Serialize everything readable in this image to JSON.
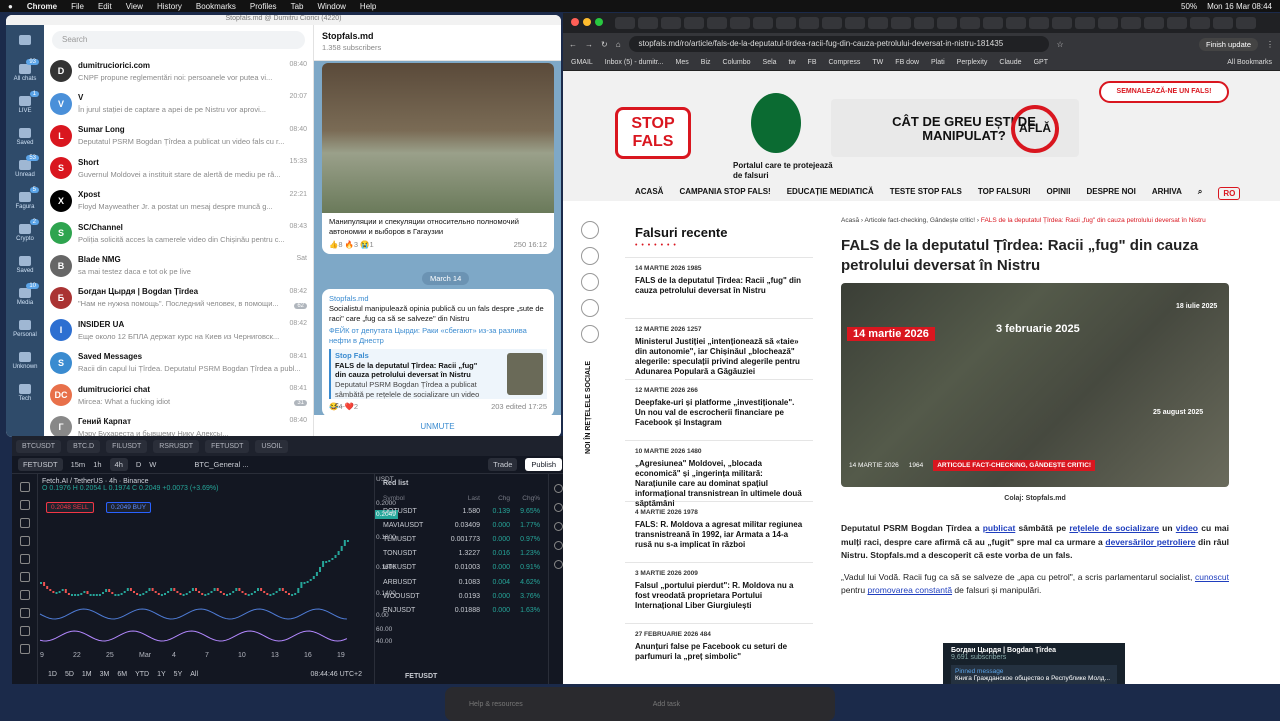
{
  "menubar": {
    "app": "Chrome",
    "items": [
      "File",
      "Edit",
      "View",
      "History",
      "Bookmarks",
      "Profiles",
      "Tab",
      "Window",
      "Help"
    ],
    "battery": "50%",
    "clock": "Mon 16 Mar 08:44"
  },
  "telegram": {
    "title": "Stopfals.md @ Dumitru Ciorici (4220)",
    "search_placeholder": "Search",
    "rail": [
      {
        "label": "All chats",
        "badge": "93"
      },
      {
        "label": "LIVE",
        "badge": "1"
      },
      {
        "label": "Saved",
        "badge": ""
      },
      {
        "label": "Unread",
        "badge": "53"
      },
      {
        "label": "Fagura",
        "badge": "5"
      },
      {
        "label": "Crypto",
        "badge": "2"
      },
      {
        "label": "Saved",
        "badge": ""
      },
      {
        "label": "Media",
        "badge": "10"
      },
      {
        "label": "Personal",
        "badge": ""
      },
      {
        "label": "Unknown",
        "badge": ""
      },
      {
        "label": "Tech",
        "badge": ""
      }
    ],
    "chats": [
      {
        "name": "dumitruciorici.com",
        "preview": "CNPF propune reglementări noi: persoanele vor putea vi...",
        "time": "08:40",
        "unread": "",
        "color": "#333",
        "initial": "D"
      },
      {
        "name": "V",
        "preview": "În jurul stației de captare a apei de pe Nistru vor aprovi...",
        "time": "20:07",
        "unread": "",
        "color": "#4a90d9",
        "initial": "V"
      },
      {
        "name": "Sumar Long",
        "preview": "Deputatul PSRM Bogdan Țîrdea a publicat un video fals cu r...",
        "time": "08:40",
        "unread": "",
        "color": "#d9161f",
        "initial": "L"
      },
      {
        "name": "Short",
        "preview": "Guvernul Moldovei a instituit stare de alertă de mediu pe râ...",
        "time": "15:33",
        "unread": "",
        "color": "#d9161f",
        "initial": "S"
      },
      {
        "name": "Xpost",
        "preview": "Floyd Mayweather Jr. a postat un mesaj despre muncă g...",
        "time": "22:21",
        "unread": "",
        "color": "#000",
        "initial": "X"
      },
      {
        "name": "SC/Channel",
        "preview": "Poliția solicită acces la camerele video din Chișinău pentru c...",
        "time": "08:43",
        "unread": "",
        "color": "#2ea44f",
        "initial": "S"
      },
      {
        "name": "Blade NMG",
        "preview": "sa mai testez daca e tot ok pe live",
        "time": "Sat",
        "unread": "",
        "color": "#666",
        "initial": "B"
      },
      {
        "name": "Богдан Цырдя | Bogdan Țîrdea",
        "preview": "\"Нам не нужна помощь\". Последний человек, в помощи...",
        "time": "08:42",
        "unread": "62",
        "color": "#a33",
        "initial": "Б"
      },
      {
        "name": "INSIDER UA",
        "preview": "Еще около 12 БПЛА держат курс на Киев из Черниговск...",
        "time": "08:42",
        "unread": "",
        "color": "#2d6fd1",
        "initial": "I"
      },
      {
        "name": "Saved Messages",
        "preview": "Racii din capul lui Țîrdea. Deputatul PSRM Bogdan Țîrdea a publ...",
        "time": "08:41",
        "unread": "",
        "color": "#3a8bd0",
        "initial": "S"
      },
      {
        "name": "dumitruciorici chat",
        "preview": "Mircea: What a fucking idiot",
        "time": "08:41",
        "unread": "31",
        "color": "#e8704a",
        "initial": "DC"
      },
      {
        "name": "Гений Карпат",
        "preview": "Мэру Бухареста и бывшему Нику Алексы...",
        "time": "08:40",
        "unread": "",
        "color": "#888",
        "initial": "Г"
      }
    ],
    "channel": {
      "name": "Stopfals.md",
      "subs": "1.358 subscribers",
      "unmute": "UNMUTE",
      "date": "March 14",
      "post1": {
        "text": "Манипуляции и спекуляции относительно полномочий автономии и выборов в Гагаузии",
        "reactions": "👍8  🔥3  😭1",
        "views": "250",
        "time": "16:12"
      },
      "post2": {
        "author": "Stopfals.md",
        "line1": "Socialistul manipulează opinia publică cu un fals despre „sute de raci\" care „fug ca să se salveze\" din Nistru",
        "line2": "ФЕЙК от депутата Цырди: Раки «сбегают» из-за разлива нефти в Днестр",
        "prev_site": "Stop Fals",
        "prev_title": "FALS de la deputatul Țîrdea: Racii „fug\" din cauza petrolului deversat în Nistru",
        "prev_desc": "Deputatul PSRM Bogdan Țîrdea a publicat sâmbătă pe rețelele de socializare un video c...",
        "reactions": "😂4  ❤️2",
        "views": "203",
        "time": "edited 17:25"
      }
    }
  },
  "tradingview": {
    "tabs": [
      "BTCUSDT",
      "BTC.D",
      "FILUSDT",
      "RSRUSDT",
      "FETUSDT",
      "USOIL"
    ],
    "symbol": "FETUSDT",
    "intervals": [
      "15m",
      "1h",
      "4h",
      "D",
      "W"
    ],
    "trade": "Trade",
    "publish": "Publish",
    "search": "BTC_General ...",
    "info": "Fetch.AI / TetherUS · 4h · Binance",
    "ohlc": "O 0.1976 H 0.2054 L 0.1974 C 0.2049 +0.0073 (+3.69%)",
    "sell": "0.2048 SELL",
    "buy": "0.2049 BUY",
    "price": "0.2049",
    "axis": [
      "0.2000",
      "0.1800",
      "0.1600",
      "0.1400",
      "0.00",
      "60.00",
      "40.00"
    ],
    "time_labels": [
      "9",
      "22",
      "25",
      "Mar",
      "4",
      "7",
      "10",
      "13",
      "16",
      "19"
    ],
    "ranges": [
      "1D",
      "5D",
      "1M",
      "3M",
      "6M",
      "YTD",
      "1Y",
      "5Y",
      "All"
    ],
    "clock": "08:44:46 UTC+2",
    "currency": "USDT",
    "watchlist": {
      "title": "Red list",
      "cols": [
        "Symbol",
        "Last",
        "Chg",
        "Chg%"
      ],
      "rows": [
        {
          "s": "DOTUSDT",
          "l": "1.580",
          "c": "0.139",
          "p": "9.65%"
        },
        {
          "s": "MAVIAUSDT",
          "l": "0.03409",
          "c": "0.000",
          "p": "1.77%"
        },
        {
          "s": "TLMUSDT",
          "l": "0.001773",
          "c": "0.000",
          "p": "0.97%"
        },
        {
          "s": "TONUSDT",
          "l": "1.3227",
          "c": "0.016",
          "p": "1.23%"
        },
        {
          "s": "UTKUSDT",
          "l": "0.01003",
          "c": "0.000",
          "p": "0.91%"
        },
        {
          "s": "ARBUSDT",
          "l": "0.1083",
          "c": "0.004",
          "p": "4.62%"
        },
        {
          "s": "WOOUSDT",
          "l": "0.0193",
          "c": "0.000",
          "p": "3.76%"
        },
        {
          "s": "ENJUSDT",
          "l": "0.01888",
          "c": "0.000",
          "p": "1.63%"
        }
      ],
      "footer": "FETUSDT"
    }
  },
  "chrome": {
    "url": "stopfals.md/ro/article/fals-de-la-deputatul-tirdea-racii-fug-din-cauza-petrolului-deversat-in-nistru-181435",
    "finish": "Finish update",
    "bookmarks": [
      "GMAIL",
      "Inbox (5) - dumitr...",
      "Mes",
      "Biz",
      "Columbo",
      "Sela",
      "tw",
      "FB",
      "Compress",
      "TW",
      "FB dow",
      "Plati",
      "Perplexity",
      "Claude",
      "GPT"
    ],
    "all_bookmarks": "All Bookmarks"
  },
  "site": {
    "logo": "STOP FALS",
    "tagline": "Portalul care te protejează de falsuri",
    "banner_q": "CÂT DE GREU EȘTI DE MANIPULAT?",
    "banner_a": "AFLĂ",
    "report": "SEMNALEAZĂ-NE UN FALS!",
    "nav": [
      "ACASĂ",
      "CAMPANIA STOP FALS!",
      "EDUCAȚIE MEDIATICĂ",
      "TESTE STOP FALS",
      "TOP FALSURI",
      "OPINII",
      "DESPRE NOI",
      "ARHIVA"
    ],
    "lang": "RO",
    "social_label": "NOI ÎN REȚELELE SOCIALE",
    "feed_title": "Falsuri recente",
    "feed": [
      {
        "date": "14 MARTIE 2026",
        "views": "1985",
        "title": "FALS de la deputatul Țîrdea: Racii „fug\" din cauza petrolului deversat în Nistru"
      },
      {
        "date": "12 MARTIE 2026",
        "views": "1257",
        "title": "Ministerul Justiției „intenționează să «taie» din autonomie\", iar Chișinăul „blochează\" alegerile: speculații privind alegerile pentru Adunarea Populară a Găgăuziei"
      },
      {
        "date": "12 MARTIE 2026",
        "views": "266",
        "title": "Deepfake-uri și platforme „investiționale\". Un nou val de escrocherii financiare pe Facebook și Instagram"
      },
      {
        "date": "10 MARTIE 2026",
        "views": "1480",
        "title": "„Agresiunea\" Moldovei, „blocada economică\" și „ingerința militară: Narațiunile care au dominat spațiul informațional transnistrean în ultimele două săptămâni"
      },
      {
        "date": "4 MARTIE 2026",
        "views": "1978",
        "title": "FALS: R. Moldova a agresat militar regiunea transnistreană în 1992, iar Armata a 14-a rusă nu s-a implicat în război"
      },
      {
        "date": "3 MARTIE 2026",
        "views": "2009",
        "title": "Falsul „portului pierdut\": R. Moldova nu a fost vreodată proprietara Portului Internațional Liber Giurgiulești"
      },
      {
        "date": "27 FEBRUARIE 2026",
        "views": "484",
        "title": "Anunțuri false pe Facebook cu seturi de parfumuri la „preț simbolic\""
      }
    ],
    "crumbs": [
      "Acasă",
      "Articole fact-checking, Gândește critic!",
      "FALS de la deputatul Țîrdea: Racii „fug\" din cauza petrolului deversat în Nistru"
    ],
    "title": "FALS de la deputatul Țîrdea: Racii „fug\" din cauza petrolului deversat în Nistru",
    "hero": {
      "d1": "14 martie 2026",
      "d2": "3 februarie 2025",
      "d3": "18 iulie 2025",
      "d4": "25 august 2025",
      "date": "14 MARTIE 2026",
      "views": "1964",
      "cat": "ARTICOLE FACT-CHECKING, GÂNDEȘTE CRITIC!"
    },
    "collage": "Colaj: Stopfals.md",
    "p1_a": "Deputatul PSRM Bogdan Țîrdea a ",
    "p1_l1": "publicat",
    "p1_b": " sâmbătă pe ",
    "p1_l2": "rețelele de socializare",
    "p1_c": " un ",
    "p1_l3": "video",
    "p1_d": " cu mai mulți raci, despre care afirmă că au „fugit\" spre mal ca urmare a ",
    "p1_l4": "deversărilor petroliere",
    "p1_e": " din râul Nistru. Stopfals.md a descoperit că este vorba de un fals.",
    "p2_a": "„Vadul lui Vodă. Racii fug ca să se salveze de „apa cu petrol\", a scris parlamentarul socialist, ",
    "p2_l1": "cunoscut",
    "p2_b": " pentru ",
    "p2_l2": "promovarea constantă",
    "p2_c": " de falsuri și manipulări.",
    "embed": {
      "name": "Богдан Цырдя | Bogdan Țîrdea",
      "subs": "9,691 subscribers",
      "pin": "Pinned message",
      "pin_text": "Книга Гражданское общество в Республике Молд..."
    }
  },
  "dock": {
    "help": "Help & resources",
    "add": "Add task"
  }
}
